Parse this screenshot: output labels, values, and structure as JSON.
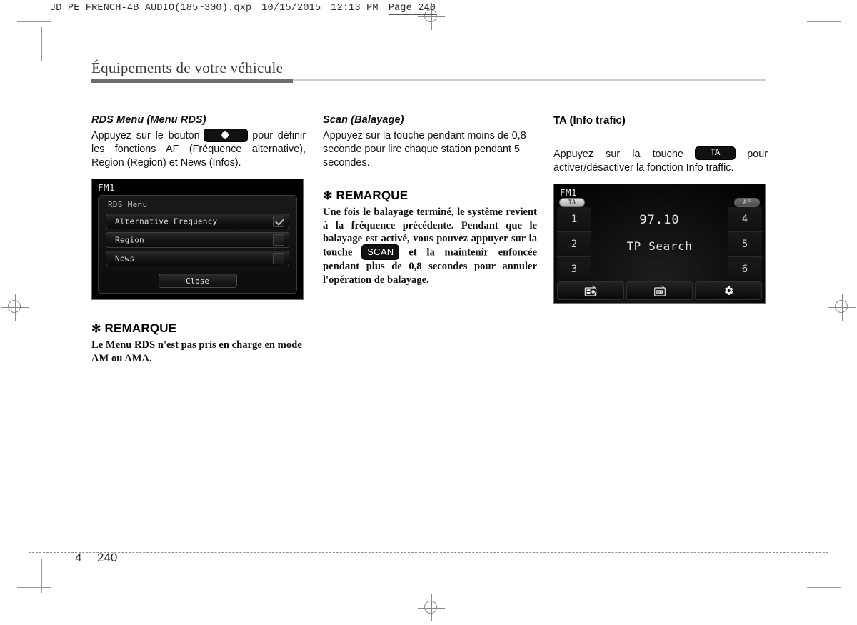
{
  "file_header": {
    "filename": "JD PE FRENCH-4B AUDIO(185~300).qxp",
    "date": "10/15/2015",
    "time": "12:13 PM",
    "page_label": "Page 240"
  },
  "chapter_title": "Équipements de votre véhicule",
  "columns": {
    "col1": {
      "heading": "RDS Menu (Menu RDS)",
      "body_part1": "Appuyez sur le bouton",
      "inline_key": "gear-icon",
      "body_part2": "pour définir les fonctions AF (Fréquence alternative), Region (Region) et News (Infos).",
      "device": {
        "title": "FM1",
        "panel_title": "RDS Menu",
        "rows": [
          {
            "label": "Alternative Frequency",
            "checked": true
          },
          {
            "label": "Region",
            "checked": false
          },
          {
            "label": "News",
            "checked": false
          }
        ],
        "close_label": "Close"
      },
      "note": {
        "star": "✻",
        "heading": "REMARQUE",
        "body": "Le Menu RDS n'est pas pris en charge en mode AM ou AMA."
      }
    },
    "col2": {
      "heading": "Scan (Balayage)",
      "body": "Appuyez sur la touche pendant moins de 0,8 seconde pour lire chaque station pendant 5 secondes.",
      "note": {
        "star": "✻",
        "heading": "REMARQUE",
        "body_part1": "Une fois le balayage terminé, le système revient à la fréquence précédente. Pendant que le balayage est activé, vous pouvez appuyer sur la touche",
        "inline_key": "SCAN",
        "body_part2": "et la maintenir enfoncée pendant plus de 0,8 secondes pour annuler l'opération de balayage."
      }
    },
    "col3": {
      "heading": "TA (Info trafic)",
      "body_part1": "Appuyez sur la touche",
      "inline_key": "TA",
      "body_part2": "pour activer/désactiver la fonction Info traffic.",
      "device": {
        "title": "FM1",
        "badge_ta": "TA",
        "badge_af": "AF",
        "presets_left": [
          "1",
          "2",
          "3"
        ],
        "presets_right": [
          "4",
          "5",
          "6"
        ],
        "frequency": "97.10",
        "status": "TP Search",
        "bottom_buttons": [
          {
            "icon": "radio-list-download-icon"
          },
          {
            "icon": "radio-auto-store-icon"
          },
          {
            "icon": "gear-icon"
          }
        ]
      }
    }
  },
  "footer": {
    "chapter": "4",
    "page": "240"
  },
  "colors": {
    "rule": "#6e6e6e",
    "rule_light": "#cdcdcd",
    "device_bg": "#000000",
    "key_badge": "#111111"
  }
}
